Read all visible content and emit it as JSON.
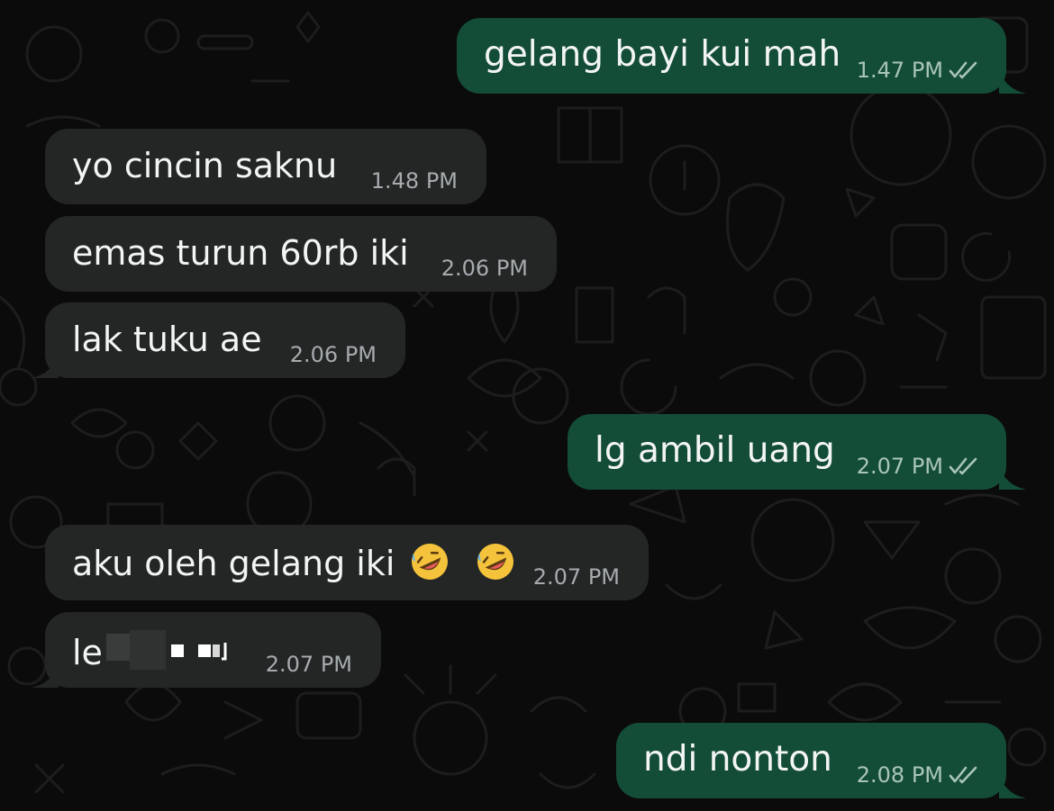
{
  "chat": {
    "messages": [
      {
        "id": "m1",
        "direction": "outgoing",
        "text": "gelang bayi kui mah",
        "time": "1.47 PM",
        "status": "read-double-check-icon"
      },
      {
        "id": "m2",
        "direction": "incoming",
        "text": "yo cincin saknu",
        "time": "1.48 PM"
      },
      {
        "id": "m3",
        "direction": "incoming",
        "text": "emas turun 60rb iki",
        "time": "2.06 PM"
      },
      {
        "id": "m4",
        "direction": "incoming",
        "text": "lak tuku ae",
        "time": "2.06 PM"
      },
      {
        "id": "m5",
        "direction": "outgoing",
        "text": "lg ambil uang",
        "time": "2.07 PM",
        "status": "read-double-check-icon"
      },
      {
        "id": "m6",
        "direction": "incoming",
        "text": "aku oleh gelang iki",
        "emoji": [
          "rolling-on-floor-laughing-icon",
          "rolling-on-floor-laughing-icon"
        ],
        "time": "2.07 PM"
      },
      {
        "id": "m7",
        "direction": "incoming",
        "text": "le",
        "redacted": true,
        "time": "2.07 PM"
      },
      {
        "id": "m8",
        "direction": "outgoing",
        "text": "ndi nonton",
        "time": "2.08 PM",
        "status": "read-double-check-icon"
      }
    ]
  },
  "colors": {
    "background": "#0b0b0b",
    "incoming_bubble": "#242626",
    "outgoing_bubble": "#144d37",
    "text": "#f3f5f5",
    "timestamp": "#a6abae",
    "wallpaper_doodle": "#1c1c1c"
  }
}
